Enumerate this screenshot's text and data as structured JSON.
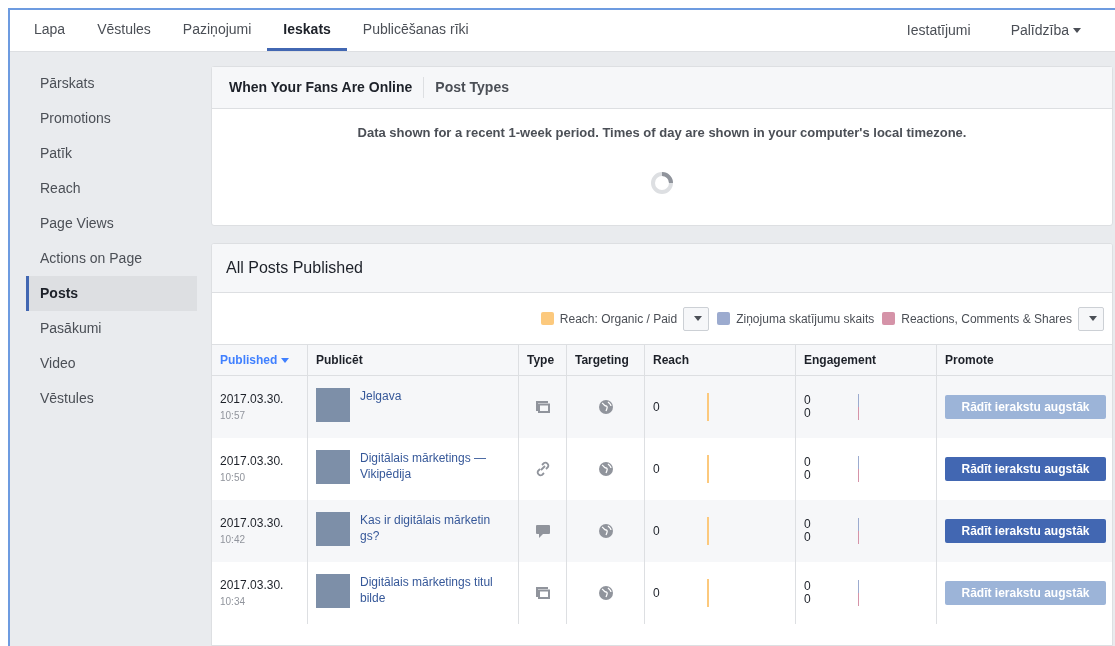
{
  "nav": {
    "left": [
      {
        "label": "Lapa",
        "selected": false
      },
      {
        "label": "Vēstules",
        "selected": false
      },
      {
        "label": "Paziņojumi",
        "selected": false
      },
      {
        "label": "Ieskats",
        "selected": true
      },
      {
        "label": "Publicēšanas rīki",
        "selected": false
      }
    ],
    "right": [
      {
        "label": "Iestatījumi",
        "dropdown": false
      },
      {
        "label": "Palīdzība",
        "dropdown": true
      }
    ]
  },
  "sidebar": {
    "items": [
      {
        "label": "Pārskats",
        "selected": false
      },
      {
        "label": "Promotions",
        "selected": false
      },
      {
        "label": "Patīk",
        "selected": false
      },
      {
        "label": "Reach",
        "selected": false
      },
      {
        "label": "Page Views",
        "selected": false
      },
      {
        "label": "Actions on Page",
        "selected": false
      },
      {
        "label": "Posts",
        "selected": true
      },
      {
        "label": "Pasākumi",
        "selected": false
      },
      {
        "label": "Video",
        "selected": false
      },
      {
        "label": "Vēstules",
        "selected": false
      }
    ]
  },
  "insights_card": {
    "tabs": [
      {
        "label": "When Your Fans Are Online",
        "selected": true
      },
      {
        "label": "Post Types",
        "selected": false
      }
    ],
    "notice": "Data shown for a recent 1-week period. Times of day are shown in your computer's local timezone.",
    "loading": true
  },
  "posts": {
    "title": "All Posts Published",
    "legend": [
      {
        "label": "Reach: Organic / Paid",
        "color": "#fcc97d",
        "dropdown": true
      },
      {
        "label": "Ziņojuma skatījumu skaits",
        "color": "#9cabcf",
        "dropdown": false
      },
      {
        "label": "Reactions, Comments & Shares",
        "color": "#d593a8",
        "dropdown": true
      }
    ],
    "columns": [
      {
        "label": "Published",
        "sorted": true
      },
      {
        "label": "Publicēt",
        "sorted": false
      },
      {
        "label": "Type",
        "sorted": false
      },
      {
        "label": "Targeting",
        "sorted": false
      },
      {
        "label": "Reach",
        "sorted": false
      },
      {
        "label": "Engagement",
        "sorted": false
      },
      {
        "label": "Promote",
        "sorted": false
      }
    ],
    "rows": [
      {
        "date": "2017.03.30.",
        "time": "10:57",
        "title": "Jelgava",
        "kind": "album",
        "reach": "0",
        "engagement": [
          "0",
          "0"
        ],
        "button": "Rādīt ierakstu augstāk",
        "disabled": true
      },
      {
        "date": "2017.03.30.",
        "time": "10:50",
        "title": "Digitālais mārketings — Vikipēdija",
        "kind": "link",
        "reach": "0",
        "engagement": [
          "0",
          "0"
        ],
        "button": "Rādīt ierakstu augstāk",
        "disabled": false
      },
      {
        "date": "2017.03.30.",
        "time": "10:42",
        "title": "Kas ir digitālais mārketin gs?",
        "kind": "status",
        "reach": "0",
        "engagement": [
          "0",
          "0"
        ],
        "button": "Rādīt ierakstu augstāk",
        "disabled": false
      },
      {
        "date": "2017.03.30.",
        "time": "10:34",
        "title": "Digitālais mārketings titul bilde",
        "kind": "album",
        "reach": "0",
        "engagement": [
          "0",
          "0"
        ],
        "button": "Rādīt ierakstu augstāk",
        "disabled": true
      }
    ]
  }
}
